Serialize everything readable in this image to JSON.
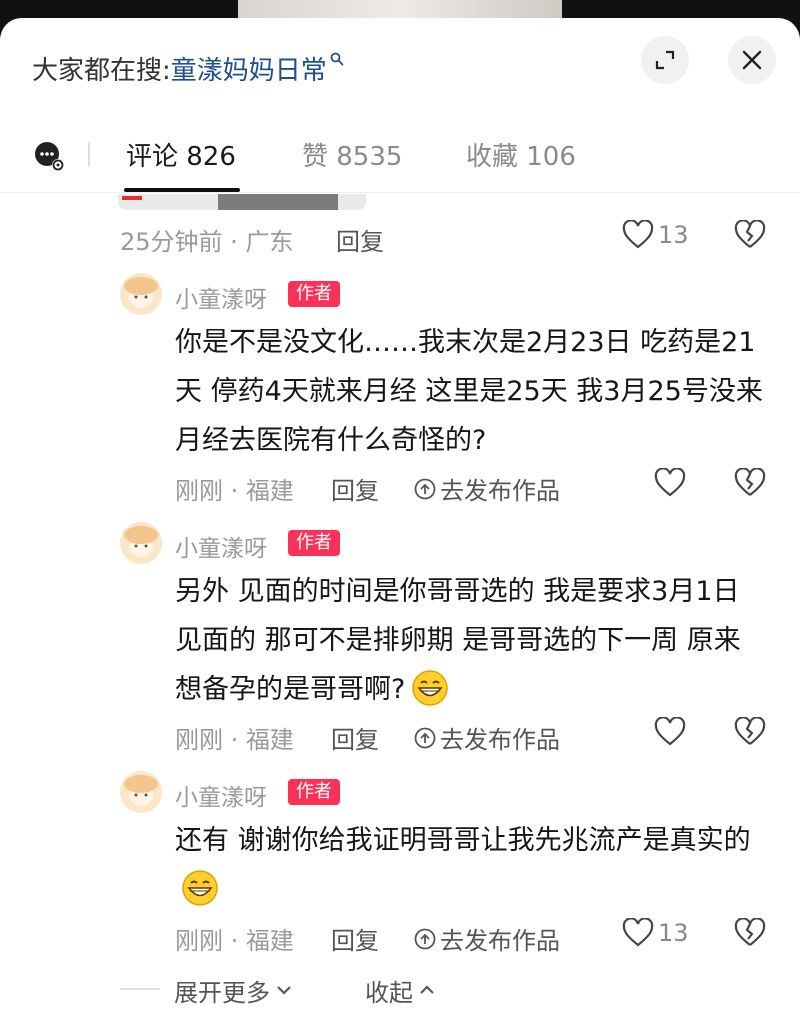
{
  "header": {
    "search_prefix": "大家都在搜:",
    "search_link": "童漾妈妈日常"
  },
  "tabs": [
    {
      "label": "评论 826",
      "active": true
    },
    {
      "label": "赞 8535",
      "active": false
    },
    {
      "label": "收藏 106",
      "active": false
    }
  ],
  "top_comment": {
    "meta": "25分钟前 · 广东",
    "reply_label": "回复",
    "like_count": "13"
  },
  "replies": [
    {
      "author": "小童漾呀",
      "tag": "作者",
      "text": "你是不是没文化……我末次是2月23日 吃药是21天 停药4天就来月经 这里是25天 我3月25号没来月经去医院有什么奇怪的?",
      "meta": "刚刚 · 福建",
      "reply_label": "回复",
      "publish_label": "去发布作品",
      "like_count": ""
    },
    {
      "author": "小童漾呀",
      "tag": "作者",
      "text": "另外 见面的时间是你哥哥选的 我是要求3月1日见面的 那可不是排卵期 是哥哥选的下一周 原来想备孕的是哥哥啊?",
      "meta": "刚刚 · 福建",
      "reply_label": "回复",
      "publish_label": "去发布作品",
      "like_count": ""
    },
    {
      "author": "小童漾呀",
      "tag": "作者",
      "text": "还有 谢谢你给我证明哥哥让我先兆流产是真实的",
      "meta": "刚刚 · 福建",
      "reply_label": "回复",
      "publish_label": "去发布作品",
      "like_count": "13"
    }
  ],
  "footer": {
    "expand_label": "展开更多",
    "collapse_label": "收起"
  },
  "colors": {
    "accent_link": "#1f4f8f",
    "author_tag": "#fb3157"
  },
  "icons": [
    "search-icon",
    "expand-icon",
    "close-icon",
    "emoji-settings-icon",
    "heart-icon",
    "broken-heart-icon",
    "upload-circle-icon",
    "grin-emoji-icon",
    "chevron-down-icon",
    "chevron-up-icon"
  ]
}
